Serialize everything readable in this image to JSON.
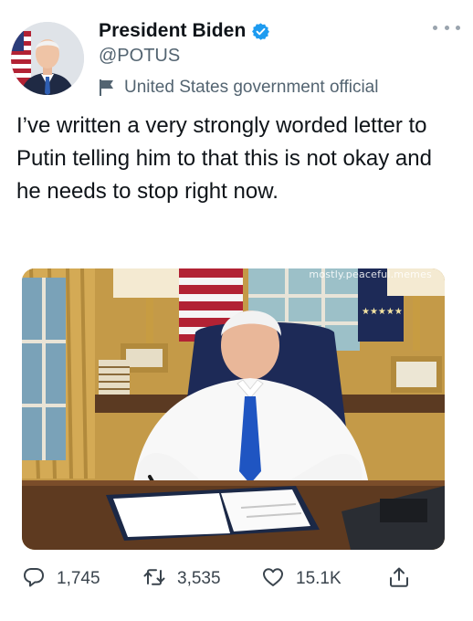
{
  "author": {
    "display_name": "President Biden",
    "handle": "@POTUS",
    "affiliation": "United States government official",
    "avatar_icon": "person-portrait",
    "verified_icon": "verified-badge",
    "verified_color": "#1d9bf0"
  },
  "tweet": {
    "text": "I’ve written a very strongly worded letter to Putin telling him to that this is not okay and he needs to stop right now."
  },
  "media": {
    "watermark": "mostly.peaceful.memes"
  },
  "actions": {
    "replies": "1,745",
    "retweets": "3,535",
    "likes": "15.1K",
    "reply_icon": "reply-icon",
    "retweet_icon": "retweet-icon",
    "like_icon": "heart-icon",
    "share_icon": "share-icon"
  }
}
